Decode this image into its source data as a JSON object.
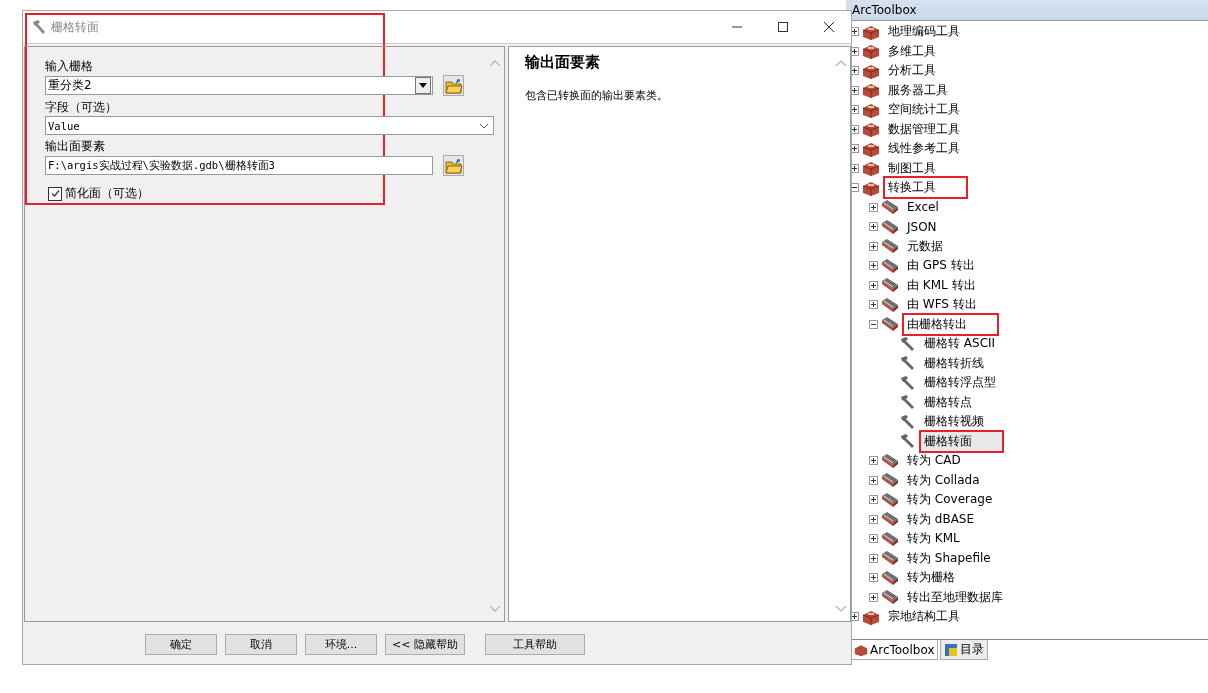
{
  "dialog": {
    "title": "栅格转面",
    "highlighted": true,
    "params": [
      {
        "kind": "combo",
        "label": "输入栅格",
        "value": "重分类2",
        "browse": true
      },
      {
        "kind": "dropdown",
        "label": "字段（可选）",
        "value": "Value",
        "browse": false
      },
      {
        "kind": "path",
        "label": "输出面要素",
        "value": "F:\\argis实战过程\\实验数据.gdb\\栅格转面3",
        "browse": true
      },
      {
        "kind": "checkbox",
        "label": "简化面（可选）",
        "checked": true
      }
    ],
    "help": {
      "title": "输出面要素",
      "text": "包含已转换面的输出要素类。"
    },
    "buttons": [
      "确定",
      "取消",
      "环境...",
      "<< 隐藏帮助",
      "工具帮助"
    ]
  },
  "toolbox": {
    "title": "ArcToolbox",
    "items": [
      {
        "kind": "toolbox",
        "label": "地理编码工具",
        "expanded": false,
        "highlighted": false
      },
      {
        "kind": "toolbox",
        "label": "多维工具",
        "expanded": false,
        "highlighted": false
      },
      {
        "kind": "toolbox",
        "label": "分析工具",
        "expanded": false,
        "highlighted": false
      },
      {
        "kind": "toolbox",
        "label": "服务器工具",
        "expanded": false,
        "highlighted": false
      },
      {
        "kind": "toolbox",
        "label": "空间统计工具",
        "expanded": false,
        "highlighted": false
      },
      {
        "kind": "toolbox",
        "label": "数据管理工具",
        "expanded": false,
        "highlighted": false
      },
      {
        "kind": "toolbox",
        "label": "线性参考工具",
        "expanded": false,
        "highlighted": false
      },
      {
        "kind": "toolbox",
        "label": "制图工具",
        "expanded": false,
        "highlighted": false
      },
      {
        "kind": "toolbox",
        "label": "转换工具",
        "expanded": true,
        "highlighted": true,
        "children": [
          {
            "kind": "toolset",
            "label": "Excel",
            "expanded": false,
            "highlighted": false
          },
          {
            "kind": "toolset",
            "label": "JSON",
            "expanded": false,
            "highlighted": false
          },
          {
            "kind": "toolset",
            "label": "元数据",
            "expanded": false,
            "highlighted": false
          },
          {
            "kind": "toolset",
            "label": "由 GPS 转出",
            "expanded": false,
            "highlighted": false
          },
          {
            "kind": "toolset",
            "label": "由 KML 转出",
            "expanded": false,
            "highlighted": false
          },
          {
            "kind": "toolset",
            "label": "由 WFS 转出",
            "expanded": false,
            "highlighted": false
          },
          {
            "kind": "toolset",
            "label": "由栅格转出",
            "expanded": true,
            "highlighted": true,
            "children": [
              {
                "kind": "tool",
                "label": "栅格转 ASCII",
                "highlighted": false,
                "selected": false
              },
              {
                "kind": "tool",
                "label": "栅格转折线",
                "highlighted": false,
                "selected": false
              },
              {
                "kind": "tool",
                "label": "栅格转浮点型",
                "highlighted": false,
                "selected": false
              },
              {
                "kind": "tool",
                "label": "栅格转点",
                "highlighted": false,
                "selected": false
              },
              {
                "kind": "tool",
                "label": "栅格转视频",
                "highlighted": false,
                "selected": false
              },
              {
                "kind": "tool",
                "label": "栅格转面",
                "highlighted": true,
                "selected": true
              }
            ]
          },
          {
            "kind": "toolset",
            "label": "转为 CAD",
            "expanded": false,
            "highlighted": false
          },
          {
            "kind": "toolset",
            "label": "转为 Collada",
            "expanded": false,
            "highlighted": false
          },
          {
            "kind": "toolset",
            "label": "转为 Coverage",
            "expanded": false,
            "highlighted": false
          },
          {
            "kind": "toolset",
            "label": "转为 dBASE",
            "expanded": false,
            "highlighted": false
          },
          {
            "kind": "toolset",
            "label": "转为 KML",
            "expanded": false,
            "highlighted": false
          },
          {
            "kind": "toolset",
            "label": "转为 Shapefile",
            "expanded": false,
            "highlighted": false
          },
          {
            "kind": "toolset",
            "label": "转为栅格",
            "expanded": false,
            "highlighted": false
          },
          {
            "kind": "toolset",
            "label": "转出至地理数据库",
            "expanded": false,
            "highlighted": false
          }
        ]
      },
      {
        "kind": "toolbox",
        "label": "宗地结构工具",
        "expanded": false,
        "highlighted": false
      }
    ],
    "tabs": [
      {
        "label": "ArcToolbox",
        "selected": true
      },
      {
        "label": "目录",
        "selected": false
      }
    ]
  }
}
